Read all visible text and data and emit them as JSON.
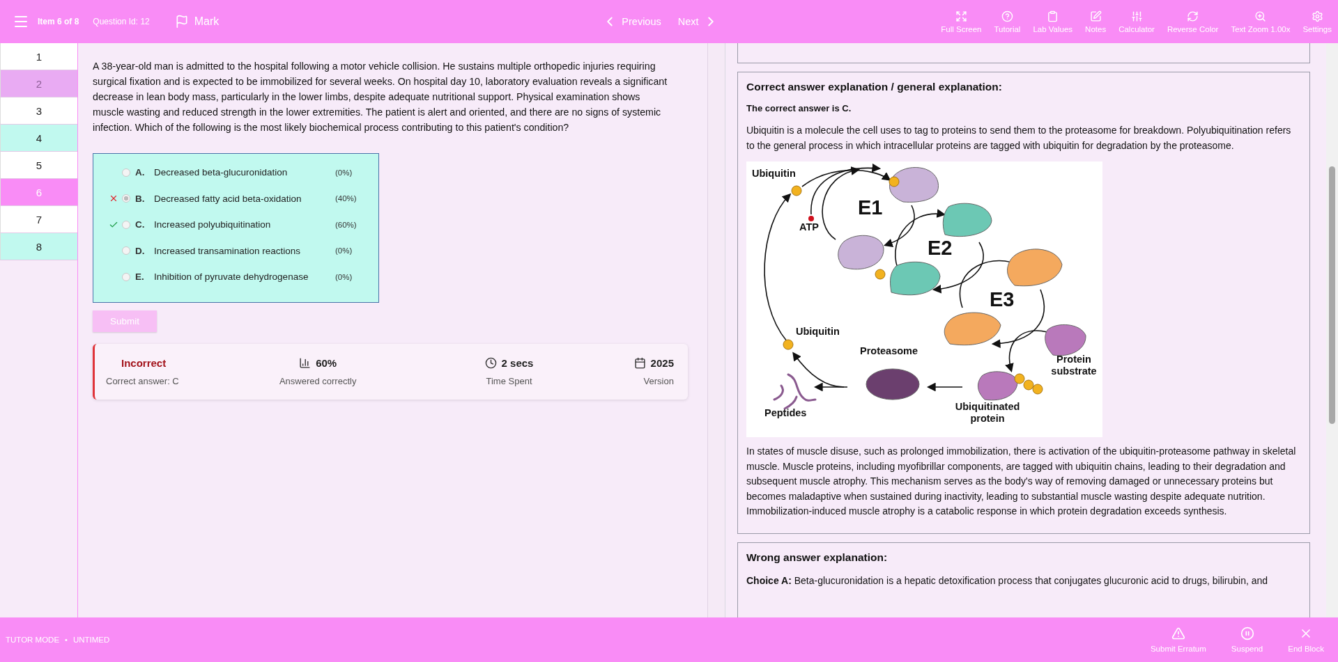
{
  "header": {
    "item_counter": "Item 6 of 8",
    "question_id": "Question Id: 12",
    "mark": "Mark",
    "previous": "Previous",
    "next": "Next",
    "tools": [
      {
        "label": "Full Screen"
      },
      {
        "label": "Tutorial"
      },
      {
        "label": "Lab Values"
      },
      {
        "label": "Notes"
      },
      {
        "label": "Calculator"
      },
      {
        "label": "Reverse Color"
      },
      {
        "label": "Text Zoom 1.00x"
      },
      {
        "label": "Settings"
      }
    ]
  },
  "sidebar": {
    "items": [
      {
        "label": "1",
        "flagged": false,
        "answered": false,
        "selected": false
      },
      {
        "label": "2",
        "flagged": true,
        "answered": false,
        "selected": false
      },
      {
        "label": "3",
        "flagged": false,
        "answered": false,
        "selected": false
      },
      {
        "label": "4",
        "flagged": false,
        "answered": true,
        "selected": false
      },
      {
        "label": "5",
        "flagged": false,
        "answered": false,
        "selected": false
      },
      {
        "label": "6",
        "flagged": false,
        "answered": true,
        "selected": true
      },
      {
        "label": "7",
        "flagged": false,
        "answered": false,
        "selected": false
      },
      {
        "label": "8",
        "flagged": false,
        "answered": true,
        "selected": false
      }
    ]
  },
  "question": {
    "stem": "A 38-year-old man is admitted to the hospital following a motor vehicle collision. He sustains multiple orthopedic injuries requiring surgical fixation and is expected to be immobilized for several weeks. On hospital day 10, laboratory evaluation reveals a significant decrease in lean body mass, particularly in the lower limbs, despite adequate nutritional support. Physical examination shows muscle wasting and reduced strength in the lower extremities. The patient is alert and oriented, and there are no signs of systemic infection. Which of the following is the most likely biochemical process contributing to this patient's condition?",
    "choices": [
      {
        "letter": "A.",
        "text": "Decreased beta-glucuronidation",
        "percent": "(0%)",
        "selected": false,
        "correct": false
      },
      {
        "letter": "B.",
        "text": "Decreased fatty acid beta-oxidation",
        "percent": "(40%)",
        "selected": true,
        "correct": false
      },
      {
        "letter": "C.",
        "text": "Increased polyubiquitination",
        "percent": "(60%)",
        "selected": false,
        "correct": true
      },
      {
        "letter": "D.",
        "text": "Increased transamination reactions",
        "percent": "(0%)",
        "selected": false,
        "correct": false
      },
      {
        "letter": "E.",
        "text": "Inhibition of pyruvate dehydrogenase",
        "percent": "(0%)",
        "selected": false,
        "correct": false
      }
    ],
    "submit": {
      "label": "Submit",
      "disabled": true
    }
  },
  "result": {
    "status": "Incorrect",
    "correct": false,
    "correct_answer": "Correct answer: C",
    "stats": [
      {
        "value": "60%",
        "label": "Answered correctly"
      },
      {
        "value": "2 secs",
        "label": "Time Spent"
      },
      {
        "value": "2025",
        "label": "Version"
      }
    ]
  },
  "explanation": {
    "title": "Correct answer explanation / general explanation:",
    "answer": "The correct answer is C.",
    "intro": "Ubiquitin is a molecule the cell uses to tag to proteins to send them to the proteasome for breakdown. Polyubiquitination refers to the general process in which intracellular proteins are tagged with ubiquitin for degradation by the proteasome.",
    "figure_labels": [
      "Ubiquitin",
      "E1",
      "ATP",
      "E2",
      "E3",
      "Ubiquitin",
      "Proteasome",
      "Protein substrate",
      "Peptides",
      "Ubiquitinated protein"
    ],
    "body": "In states of muscle disuse, such as prolonged immobilization, there is activation of the ubiquitin-proteasome pathway in skeletal muscle. Muscle proteins, including myofibrillar components, are tagged with ubiquitin chains, leading to their degradation and subsequent muscle atrophy. This mechanism serves as the body's way of removing damaged or unnecessary proteins but becomes maladaptive when sustained during inactivity, leading to substantial muscle wasting despite adequate nutrition. Immobilization-induced muscle atrophy is a catabolic response in which protein degradation exceeds synthesis.",
    "wrong_title": "Wrong answer explanation:",
    "wrong_text": "**Choice A:** Beta-glucuronidation is a hepatic detoxification process that conjugates glucuronic acid to drugs, bilirubin, and"
  },
  "footer": {
    "mode": "TUTOR MODE",
    "separator": "•",
    "timing": "UNTIMED",
    "buttons": [
      {
        "label": "Submit Erratum"
      },
      {
        "label": "Suspend"
      },
      {
        "label": "End Block"
      }
    ]
  }
}
